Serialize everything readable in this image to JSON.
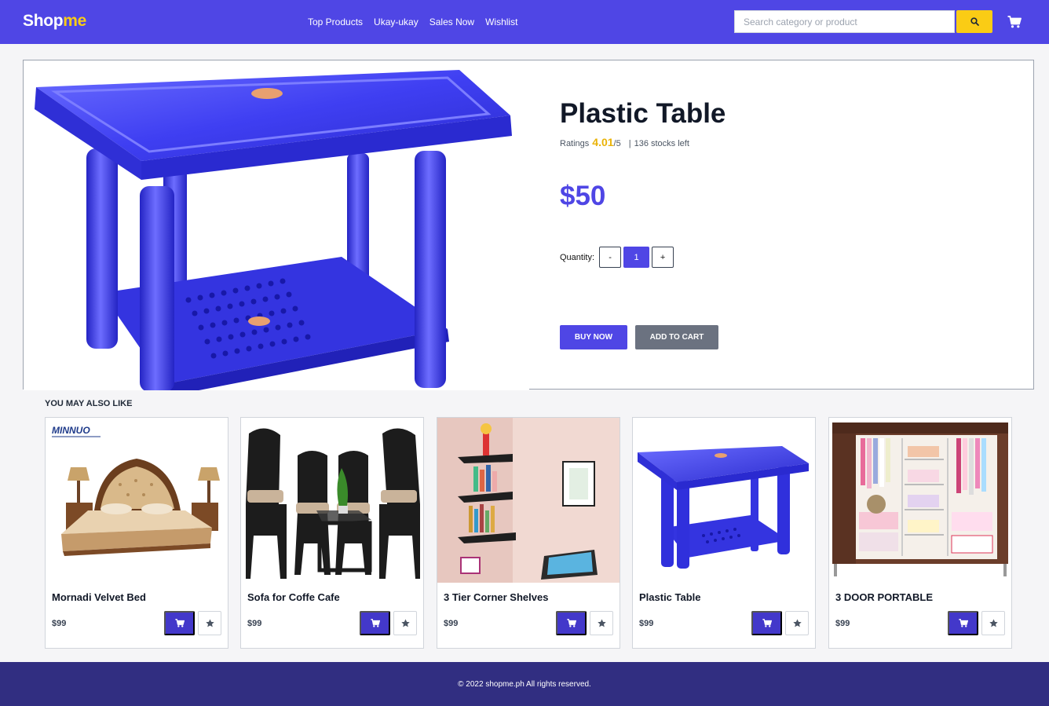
{
  "header": {
    "logo_main": "Shop",
    "logo_accent": "me",
    "nav": [
      "Top Products",
      "Ukay-ukay",
      "Sales Now",
      "Wishlist"
    ],
    "search_placeholder": "Search category or product"
  },
  "product": {
    "title": "Plastic Table",
    "ratings_label": "Ratings",
    "rating": "4.01",
    "rating_max": "/5",
    "stock_text": "136 stocks left",
    "price": "$50",
    "quantity_label": "Quantity:",
    "decrement": "-",
    "quantity": "1",
    "increment": "+",
    "buy_label": "BUY NOW",
    "add_cart_label": "ADD TO CART"
  },
  "recommendations": {
    "title": "YOU MAY ALSO LIKE",
    "items": [
      {
        "name": "Mornadi Velvet Bed",
        "price": "$99",
        "brand": "MINNUO"
      },
      {
        "name": "Sofa for Coffe Cafe",
        "price": "$99"
      },
      {
        "name": "3 Tier Corner Shelves",
        "price": "$99"
      },
      {
        "name": "Plastic Table",
        "price": "$99"
      },
      {
        "name": "3 DOOR PORTABLE",
        "price": "$99"
      }
    ]
  },
  "footer": {
    "copyright": "© 2022 shopme.ph All rights reserved."
  },
  "colors": {
    "primary": "#4f46e5",
    "accent": "#facc15",
    "footer": "#312e81",
    "secondary": "#6b7280"
  },
  "icons": {
    "search": "search-icon",
    "cart": "cart-icon",
    "star": "star-icon"
  }
}
